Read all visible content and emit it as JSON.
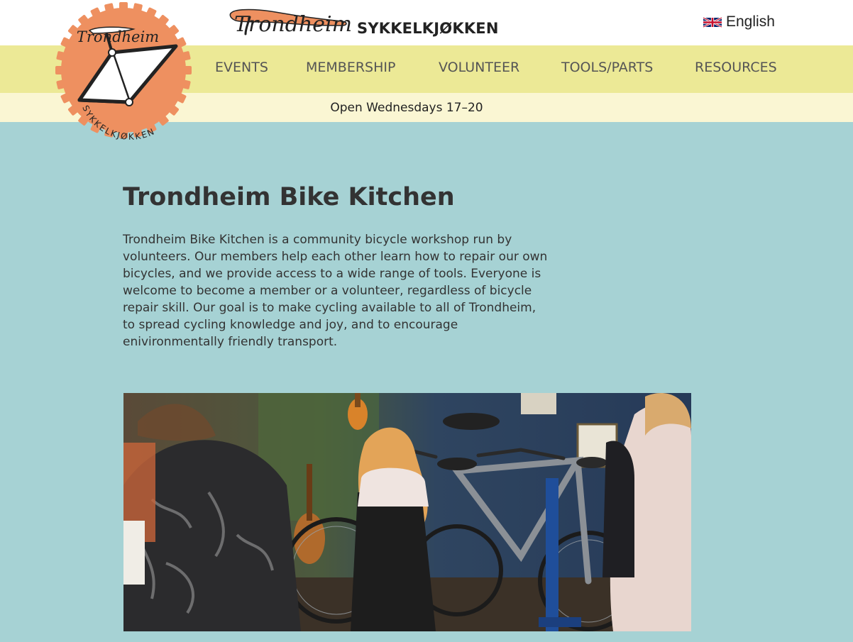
{
  "header": {
    "wordmark_script": "Trondheim",
    "wordmark_text": "SYKKELKJØKKEN",
    "language": {
      "label": "English",
      "icon": "uk-flag-icon"
    }
  },
  "logo": {
    "top_text": "Trondheim",
    "ring_text": "SYKKELKJØKKEN",
    "accent": "#ee9060"
  },
  "nav": {
    "items": [
      {
        "label": "EVENTS"
      },
      {
        "label": "MEMBERSHIP"
      },
      {
        "label": "VOLUNTEER"
      },
      {
        "label": "TOOLS/PARTS"
      },
      {
        "label": "RESOURCES"
      }
    ]
  },
  "hours": "Open Wednesdays 17–20",
  "main": {
    "title": "Trondheim Bike Kitchen",
    "intro": "Trondheim Bike Kitchen is a community bicycle workshop run by volunteers. Our members help each other learn how to repair our own bicycles, and we provide access to a wide range of tools. Everyone is welcome to become a member or a volunteer, regardless of bicycle repair skill. Our goal is to make cycling available to all of Trondheim, to spread cycling knowledge and joy, and to encourage enivironmentally friendly transport."
  },
  "colors": {
    "background": "#a6d2d4",
    "nav_bar": "#ece996",
    "hours_bar": "#faf6d3",
    "logo_orange": "#ee9060"
  }
}
